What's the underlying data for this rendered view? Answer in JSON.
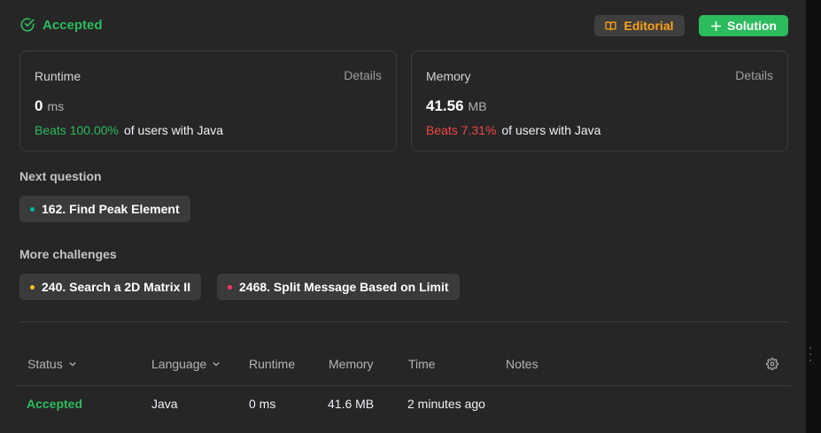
{
  "header": {
    "status": "Accepted",
    "editorial_label": "Editorial",
    "solution_label": "Solution"
  },
  "runtime_card": {
    "title": "Runtime",
    "details": "Details",
    "value": "0",
    "unit": "ms",
    "beats_label": "Beats 100.00%",
    "beats_suffix": "of users with Java"
  },
  "memory_card": {
    "title": "Memory",
    "details": "Details",
    "value": "41.56",
    "unit": "MB",
    "beats_label": "Beats 7.31%",
    "beats_suffix": "of users with Java"
  },
  "next_question": {
    "label": "Next question",
    "item": {
      "title": "162. Find Peak Element",
      "difficulty_color": "#00b8a3"
    }
  },
  "more_challenges": {
    "label": "More challenges",
    "items": [
      {
        "title": "240. Search a 2D Matrix II",
        "difficulty_color": "#ffc01e"
      },
      {
        "title": "2468. Split Message Based on Limit",
        "difficulty_color": "#ff375f"
      }
    ]
  },
  "submissions": {
    "columns": [
      "Status",
      "Language",
      "Runtime",
      "Memory",
      "Time",
      "Notes"
    ],
    "rows": [
      {
        "status": "Accepted",
        "language": "Java",
        "runtime": "0 ms",
        "memory": "41.6 MB",
        "time": "2 minutes ago",
        "notes": ""
      }
    ]
  },
  "colors": {
    "accent_green": "#2cbb5d",
    "accent_orange": "#ffa116",
    "accent_red": "#ef4743",
    "panel_bg": "#262626"
  }
}
